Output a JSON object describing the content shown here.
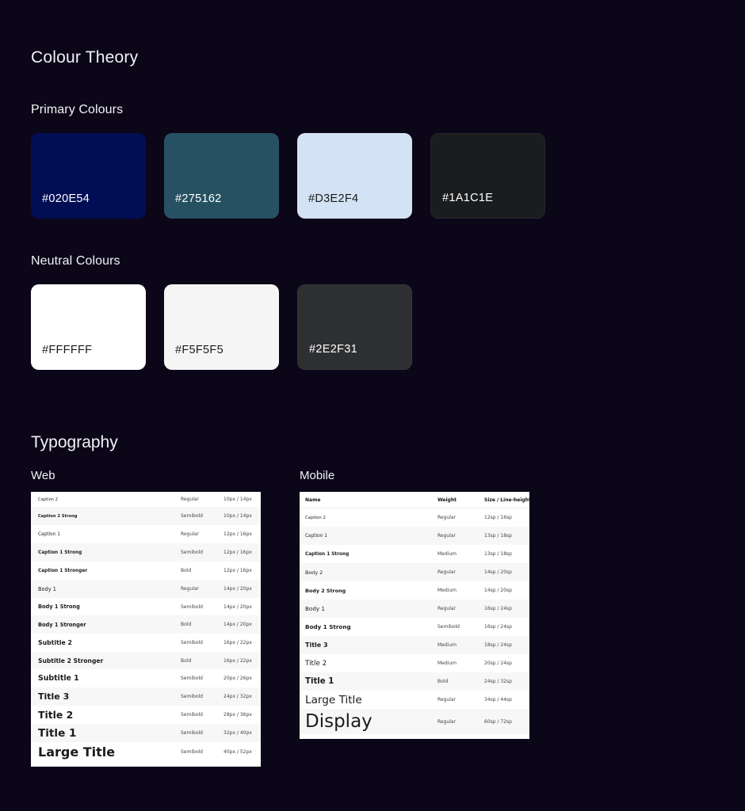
{
  "colour_theory": {
    "title": "Colour Theory",
    "primary_title": "Primary Colours",
    "primary": [
      {
        "code": "#020E54",
        "color": "#020E54",
        "text_color": "#FFFFFF"
      },
      {
        "code": "#275162",
        "color": "#275162",
        "text_color": "#FFFFFF"
      },
      {
        "code": "#D3E2F4",
        "color": "#D3E2F4",
        "text_color": "#1A1A1A"
      },
      {
        "code": "#1A1C1E",
        "color": "#1A1C1E",
        "text_color": "#FFFFFF"
      }
    ],
    "neutral_title": "Neutral  Colours",
    "neutral": [
      {
        "code": "#FFFFFF",
        "color": "#FFFFFF",
        "text_color": "#1A1A1A"
      },
      {
        "code": "#F5F5F5",
        "color": "#F5F5F5",
        "text_color": "#1A1A1A"
      },
      {
        "code": "#2E2F31",
        "color": "#2E2F31",
        "text_color": "#FFFFFF"
      }
    ]
  },
  "typography": {
    "title": "Typography",
    "web": {
      "label": "Web",
      "rows": [
        {
          "name": "Caption 2",
          "weight": "Regular",
          "size": "10px / 14px"
        },
        {
          "name": "Caption 2 Strong",
          "weight": "Semibold",
          "size": "10px / 14px"
        },
        {
          "name": "Caption 1",
          "weight": "Regular",
          "size": "12px / 16px"
        },
        {
          "name": "Caption 1 Strong",
          "weight": "Semibold",
          "size": "12px / 16px"
        },
        {
          "name": "Caption 1 Stronger",
          "weight": "Bold",
          "size": "12px / 16px"
        },
        {
          "name": "Body 1",
          "weight": "Regular",
          "size": "14px / 20px"
        },
        {
          "name": "Body 1 Strong",
          "weight": "Semibold",
          "size": "14px / 20px"
        },
        {
          "name": "Body 1 Stronger",
          "weight": "Bold",
          "size": "14px / 20px"
        },
        {
          "name": "Subtitle 2",
          "weight": "Semibold",
          "size": "16px / 22px"
        },
        {
          "name": "Subtitle 2 Stronger",
          "weight": "Bold",
          "size": "16px / 22px"
        },
        {
          "name": "Subtitle 1",
          "weight": "Semibold",
          "size": "20px / 26px"
        },
        {
          "name": "Title 3",
          "weight": "Semibold",
          "size": "24px / 32px"
        },
        {
          "name": "Title 2",
          "weight": "Semibold",
          "size": "28px / 36px"
        },
        {
          "name": "Title 1",
          "weight": "Semibold",
          "size": "32px / 40px"
        },
        {
          "name": "Large Title",
          "weight": "Semibold",
          "size": "40px / 52px"
        }
      ]
    },
    "mobile": {
      "label": "Mobile",
      "header": {
        "name": "Name",
        "weight": "Weight",
        "size": "Size / Line-height"
      },
      "rows": [
        {
          "name": "Caption 2",
          "weight": "Regular",
          "size": "12sp / 16sp"
        },
        {
          "name": "Caption 1",
          "weight": "Regular",
          "size": "13sp / 18sp"
        },
        {
          "name": "Caption 1 Strong",
          "weight": "Medium",
          "size": "13sp / 18sp"
        },
        {
          "name": "Body 2",
          "weight": "Regular",
          "size": "14sp / 20sp"
        },
        {
          "name": "Body 2 Strong",
          "weight": "Medium",
          "size": "14sp / 20sp"
        },
        {
          "name": "Body 1",
          "weight": "Regular",
          "size": "16sp / 24sp"
        },
        {
          "name": "Body 1 Strong",
          "weight": "Semibold",
          "size": "16sp / 24sp"
        },
        {
          "name": "Title 3",
          "weight": "Medium",
          "size": "18sp / 24sp"
        },
        {
          "name": "Title 2",
          "weight": "Medium",
          "size": "20sp / 24sp"
        },
        {
          "name": "Title 1",
          "weight": "Bold",
          "size": "24sp / 32sp"
        },
        {
          "name": "Large Title",
          "weight": "Regular",
          "size": "34sp / 44sp"
        },
        {
          "name": "Display",
          "weight": "Regular",
          "size": "60sp / 72sp"
        }
      ]
    }
  }
}
